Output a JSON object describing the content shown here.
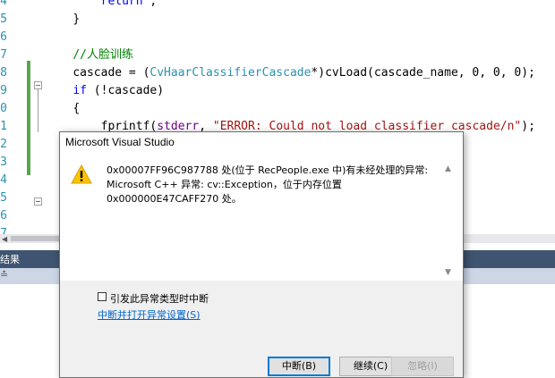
{
  "editor": {
    "line_numbers": [
      "4",
      "5",
      "6",
      "7",
      "8",
      "9",
      "0",
      "1",
      "2",
      "3",
      "4",
      "5",
      "6",
      "7"
    ],
    "lines": [
      {
        "indent": "        ",
        "tokens": [
          {
            "t": "return",
            "c": "kw"
          },
          {
            "t": " ;",
            "c": ""
          }
        ]
      },
      {
        "indent": "    ",
        "tokens": [
          {
            "t": "}",
            "c": ""
          }
        ]
      },
      {
        "indent": "",
        "tokens": []
      },
      {
        "indent": "    ",
        "tokens": [
          {
            "t": "//人脸训练",
            "c": "cm"
          }
        ]
      },
      {
        "indent": "    ",
        "tokens": [
          {
            "t": "cascade = (",
            "c": ""
          },
          {
            "t": "CvHaarClassifierCascade",
            "c": "ty"
          },
          {
            "t": "*)cvLoad(cascade_name, 0, 0, 0);",
            "c": ""
          }
        ]
      },
      {
        "indent": "    ",
        "tokens": [
          {
            "t": "if",
            "c": "kw"
          },
          {
            "t": " (!cascade)",
            "c": ""
          }
        ]
      },
      {
        "indent": "    ",
        "tokens": [
          {
            "t": "{",
            "c": ""
          }
        ]
      },
      {
        "indent": "        ",
        "tokens": [
          {
            "t": "fprintf(",
            "c": ""
          },
          {
            "t": "stderr",
            "c": "mc"
          },
          {
            "t": ", ",
            "c": ""
          },
          {
            "t": "\"ERROR: Could not load classifier cascade/n\"",
            "c": "st"
          },
          {
            "t": ");",
            "c": ""
          }
        ]
      },
      {
        "indent": "    ",
        "tokens": [
          {
            "t": "}",
            "c": ""
          }
        ]
      }
    ]
  },
  "output_panel": {
    "title": "结果",
    "toolbar_icon": "≛"
  },
  "dialog": {
    "title": "Microsoft Visual Studio",
    "icon": "warning-icon",
    "message": "0x00007FF96C987788 处(位于 RecPeople.exe 中)有未经处理的异常: Microsoft C++ 异常: cv::Exception，位于内存位置 0x000000E47CAFF270 处。",
    "checkbox_label": "引发此异常类型时中断",
    "checkbox_checked": false,
    "link_text": "中断并打开异常设置(S)",
    "buttons": {
      "break": "中断(B)",
      "continue": "继续(C)",
      "ignore": "忽略(I)"
    }
  },
  "colors": {
    "keyword": "#0000ff",
    "comment": "#008000",
    "type": "#2b91af",
    "string": "#a31515",
    "change_bar": "#57a64a",
    "panel_header": "#3e5470",
    "link": "#0066cc",
    "warning": "#fcc400"
  }
}
